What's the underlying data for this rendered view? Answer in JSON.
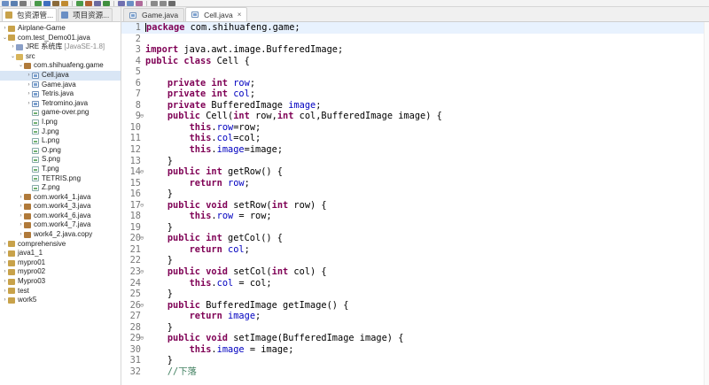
{
  "toolbar": {
    "buttons": [
      "new-icon",
      "save-icon",
      "print-icon",
      "run-icon",
      "debug-icon",
      "search-icon",
      "back-icon",
      "forward-icon",
      "external-tools-icon",
      "package-icon",
      "class-icon",
      "open-type-icon",
      "task-icon",
      "annotation-icon",
      "nav-back-icon",
      "nav-forward-icon",
      "maximize-icon"
    ]
  },
  "left_panel": {
    "tabs": [
      {
        "label": "包资源管...",
        "active": true
      },
      {
        "label": "项目资源...",
        "active": false
      }
    ],
    "tree": [
      {
        "label": "Airplane-Game",
        "depth": 0,
        "icon": "project",
        "expander": "›"
      },
      {
        "label": "com.test_Demo01.java",
        "depth": 0,
        "icon": "project",
        "expander": "⌄"
      },
      {
        "label": "JRE 系统库",
        "tag": "[JavaSE-1.8]",
        "depth": 1,
        "icon": "library",
        "expander": "›"
      },
      {
        "label": "src",
        "depth": 1,
        "icon": "source-folder",
        "expander": "⌄"
      },
      {
        "label": "com.shihuafeng.game",
        "depth": 2,
        "icon": "package",
        "expander": "⌄"
      },
      {
        "label": "Cell.java",
        "depth": 3,
        "icon": "java-file",
        "expander": "›",
        "selected": true
      },
      {
        "label": "Game.java",
        "depth": 3,
        "icon": "java-file",
        "expander": "›"
      },
      {
        "label": "Tetris.java",
        "depth": 3,
        "icon": "java-file",
        "expander": "›"
      },
      {
        "label": "Tetromino.java",
        "depth": 3,
        "icon": "java-file",
        "expander": "›"
      },
      {
        "label": "game-over.png",
        "depth": 3,
        "icon": "image-file",
        "expander": ""
      },
      {
        "label": "I.png",
        "depth": 3,
        "icon": "image-file",
        "expander": ""
      },
      {
        "label": "J.png",
        "depth": 3,
        "icon": "image-file",
        "expander": ""
      },
      {
        "label": "L.png",
        "depth": 3,
        "icon": "image-file",
        "expander": ""
      },
      {
        "label": "O.png",
        "depth": 3,
        "icon": "image-file",
        "expander": ""
      },
      {
        "label": "S.png",
        "depth": 3,
        "icon": "image-file",
        "expander": ""
      },
      {
        "label": "T.png",
        "depth": 3,
        "icon": "image-file",
        "expander": ""
      },
      {
        "label": "TETRIS.png",
        "depth": 3,
        "icon": "image-file",
        "expander": ""
      },
      {
        "label": "Z.png",
        "depth": 3,
        "icon": "image-file",
        "expander": ""
      },
      {
        "label": "com.work4_1.java",
        "depth": 2,
        "icon": "package",
        "expander": "›"
      },
      {
        "label": "com.work4_3.java",
        "depth": 2,
        "icon": "package",
        "expander": "›"
      },
      {
        "label": "com.work4_6.java",
        "depth": 2,
        "icon": "package",
        "expander": "›"
      },
      {
        "label": "com.work4_7.java",
        "depth": 2,
        "icon": "package",
        "expander": "›"
      },
      {
        "label": "work4_2.java.copy",
        "depth": 2,
        "icon": "package",
        "expander": "›"
      },
      {
        "label": "comprehensive",
        "depth": 0,
        "icon": "project",
        "expander": "›"
      },
      {
        "label": "java1_1",
        "depth": 0,
        "icon": "project",
        "expander": "›"
      },
      {
        "label": "mypro01",
        "depth": 0,
        "icon": "project",
        "expander": "›"
      },
      {
        "label": "mypro02",
        "depth": 0,
        "icon": "project",
        "expander": "›"
      },
      {
        "label": "Mypro03",
        "depth": 0,
        "icon": "project",
        "expander": "›"
      },
      {
        "label": "test",
        "depth": 0,
        "icon": "project",
        "expander": "›"
      },
      {
        "label": "work5",
        "depth": 0,
        "icon": "project",
        "expander": "›"
      }
    ]
  },
  "editor": {
    "tabs": [
      {
        "label": "Game.java",
        "active": false
      },
      {
        "label": "Cell.java",
        "active": true
      }
    ],
    "current_line": 1,
    "lines": [
      {
        "n": "1",
        "fold": "",
        "html": "<span class=\"caret\"></span><span class=\"kw\">package</span> com.shihuafeng.game;"
      },
      {
        "n": "2",
        "fold": "",
        "html": ""
      },
      {
        "n": "3",
        "fold": "",
        "html": "<span class=\"kw\">import</span> java.awt.image.BufferedImage;"
      },
      {
        "n": "4",
        "fold": "",
        "html": "<span class=\"kw\">public class</span> Cell {"
      },
      {
        "n": "5",
        "fold": "",
        "html": ""
      },
      {
        "n": "6",
        "fold": "",
        "html": "    <span class=\"kw\">private int</span> <span class=\"fld\">row</span>;"
      },
      {
        "n": "7",
        "fold": "",
        "html": "    <span class=\"kw\">private int</span> <span class=\"fld\">col</span>;"
      },
      {
        "n": "8",
        "fold": "",
        "html": "    <span class=\"kw\">private</span> BufferedImage <span class=\"fld\">image</span>;"
      },
      {
        "n": "9",
        "fold": "⊖",
        "html": "    <span class=\"kw\">public</span> Cell(<span class=\"kw\">int</span> row,<span class=\"kw\">int</span> col,BufferedImage image) {"
      },
      {
        "n": "10",
        "fold": "",
        "html": "        <span class=\"kw\">this</span>.<span class=\"fld\">row</span>=row;"
      },
      {
        "n": "11",
        "fold": "",
        "html": "        <span class=\"kw\">this</span>.<span class=\"fld\">col</span>=col;"
      },
      {
        "n": "12",
        "fold": "",
        "html": "        <span class=\"kw\">this</span>.<span class=\"fld\">image</span>=image;"
      },
      {
        "n": "13",
        "fold": "",
        "html": "    }"
      },
      {
        "n": "14",
        "fold": "⊖",
        "html": "    <span class=\"kw\">public int</span> getRow() {"
      },
      {
        "n": "15",
        "fold": "",
        "html": "        <span class=\"kw\">return</span> <span class=\"fld\">row</span>;"
      },
      {
        "n": "16",
        "fold": "",
        "html": "    }"
      },
      {
        "n": "17",
        "fold": "⊖",
        "html": "    <span class=\"kw\">public void</span> setRow(<span class=\"kw\">int</span> row) {"
      },
      {
        "n": "18",
        "fold": "",
        "html": "        <span class=\"kw\">this</span>.<span class=\"fld\">row</span> = row;"
      },
      {
        "n": "19",
        "fold": "",
        "html": "    }"
      },
      {
        "n": "20",
        "fold": "⊖",
        "html": "    <span class=\"kw\">public int</span> getCol() {"
      },
      {
        "n": "21",
        "fold": "",
        "html": "        <span class=\"kw\">return</span> <span class=\"fld\">col</span>;"
      },
      {
        "n": "22",
        "fold": "",
        "html": "    }"
      },
      {
        "n": "23",
        "fold": "⊖",
        "html": "    <span class=\"kw\">public void</span> setCol(<span class=\"kw\">int</span> col) {"
      },
      {
        "n": "24",
        "fold": "",
        "html": "        <span class=\"kw\">this</span>.<span class=\"fld\">col</span> = col;"
      },
      {
        "n": "25",
        "fold": "",
        "html": "    }"
      },
      {
        "n": "26",
        "fold": "⊖",
        "html": "    <span class=\"kw\">public</span> BufferedImage getImage() {"
      },
      {
        "n": "27",
        "fold": "",
        "html": "        <span class=\"kw\">return</span> <span class=\"fld\">image</span>;"
      },
      {
        "n": "28",
        "fold": "",
        "html": "    }"
      },
      {
        "n": "29",
        "fold": "⊖",
        "html": "    <span class=\"kw\">public void</span> setImage(BufferedImage image) {"
      },
      {
        "n": "30",
        "fold": "",
        "html": "        <span class=\"kw\">this</span>.<span class=\"fld\">image</span> = image;"
      },
      {
        "n": "31",
        "fold": "",
        "html": "    }"
      },
      {
        "n": "32",
        "fold": "",
        "html": "    <span class=\"cmt\">//下落</span>"
      }
    ]
  },
  "colors": {
    "keyword": "#7f0055",
    "field": "#0000c0",
    "comment": "#3f7f5f",
    "line_number": "#787878",
    "current_line_bg": "#e8f2fe",
    "selected_tree_bg": "#d9e6f5"
  }
}
